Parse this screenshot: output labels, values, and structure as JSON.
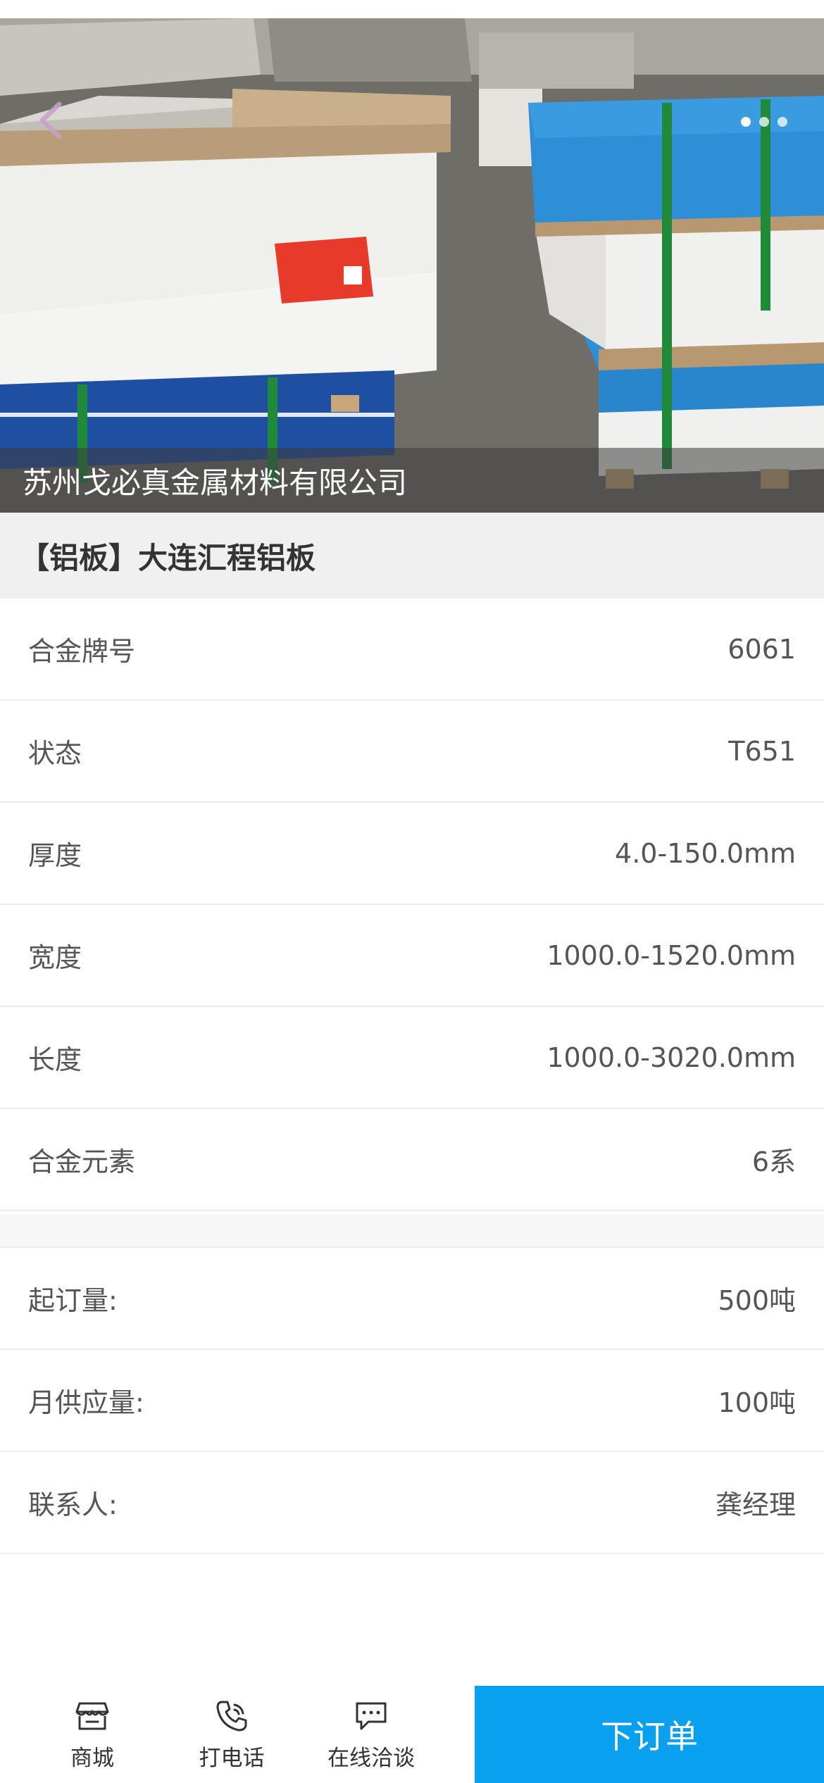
{
  "banner": {
    "caption": "苏州戈必真金属材料有限公司",
    "dot_count": 3
  },
  "product": {
    "title": "【铝板】大连汇程铝板"
  },
  "specs": [
    {
      "label": "合金牌号",
      "value": "6061"
    },
    {
      "label": "状态",
      "value": "T651"
    },
    {
      "label": "厚度",
      "value": "4.0-150.0mm"
    },
    {
      "label": "宽度",
      "value": "1000.0-1520.0mm"
    },
    {
      "label": "长度",
      "value": "1000.0-3020.0mm"
    },
    {
      "label": "合金元素",
      "value": "6系"
    }
  ],
  "order_info": [
    {
      "label": "起订量:",
      "value": "500吨"
    },
    {
      "label": "月供应量:",
      "value": "100吨"
    },
    {
      "label": "联系人:",
      "value": "龚经理"
    }
  ],
  "bottom_bar": {
    "items": [
      {
        "label": "商城",
        "icon": "store-icon"
      },
      {
        "label": "打电话",
        "icon": "phone-icon"
      },
      {
        "label": "在线洽谈",
        "icon": "chat-icon"
      }
    ],
    "order_button": "下订单",
    "accent_color": "#0aa0f0"
  }
}
